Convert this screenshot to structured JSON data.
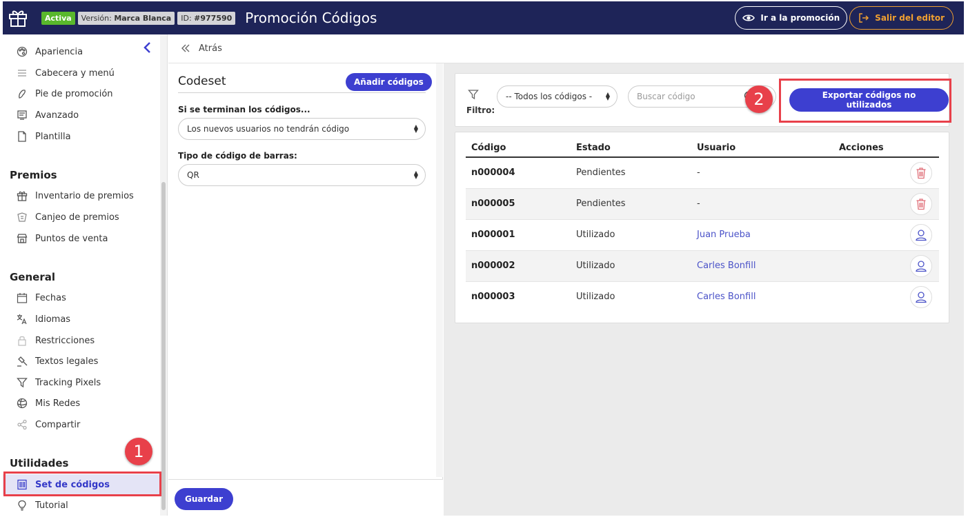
{
  "header": {
    "status_badge": "Activa",
    "version_label": "Versión:",
    "version_value": "Marca Blanca",
    "id_label": "ID:",
    "id_value": "#977590",
    "title": "Promoción Códigos",
    "go_button": "Ir a la promoción",
    "exit_button": "Salir del editor"
  },
  "sidebar": {
    "items_top": [
      {
        "label": "Apariencia",
        "icon": "palette-icon"
      },
      {
        "label": "Cabecera y menú",
        "icon": "menu-icon"
      },
      {
        "label": "Pie de promoción",
        "icon": "footer-icon"
      },
      {
        "label": "Avanzado",
        "icon": "advanced-icon"
      },
      {
        "label": "Plantilla",
        "icon": "template-icon"
      }
    ],
    "section_premios": "Premios",
    "items_premios": [
      {
        "label": "Inventario de premios",
        "icon": "gift-icon"
      },
      {
        "label": "Canjeo de premios",
        "icon": "redeem-icon"
      },
      {
        "label": "Puntos de venta",
        "icon": "store-icon"
      }
    ],
    "section_general": "General",
    "items_general": [
      {
        "label": "Fechas",
        "icon": "calendar-icon"
      },
      {
        "label": "Idiomas",
        "icon": "translate-icon"
      },
      {
        "label": "Restricciones",
        "icon": "lock-icon"
      },
      {
        "label": "Textos legales",
        "icon": "gavel-icon"
      },
      {
        "label": "Tracking Pixels",
        "icon": "funnel-icon"
      },
      {
        "label": "Mis Redes",
        "icon": "network-icon"
      },
      {
        "label": "Compartir",
        "icon": "share-icon"
      }
    ],
    "section_utilidades": "Utilidades",
    "items_utilidades": [
      {
        "label": "Set de códigos",
        "icon": "barcode-icon",
        "active": true
      },
      {
        "label": "Tutorial",
        "icon": "lightbulb-icon"
      }
    ]
  },
  "markers": {
    "one": "1",
    "two": "2"
  },
  "backbar": {
    "label": "Atrás"
  },
  "codeset": {
    "title": "Codeset",
    "add_button": "Añadir códigos",
    "end_label": "Si se terminan los códigos...",
    "end_value": "Los nuevos usuarios no tendrán código",
    "barcode_label": "Tipo de código de barras:",
    "barcode_value": "QR",
    "save_button": "Guardar"
  },
  "filter": {
    "label": "Filtro:",
    "select_value": "-- Todos los códigos -",
    "search_placeholder": "Buscar código",
    "export_button": "Exportar códigos no utilizados"
  },
  "table": {
    "headers": [
      "Código",
      "Estado",
      "Usuario",
      "Acciones"
    ],
    "rows": [
      {
        "code": "n000004",
        "state": "Pendientes",
        "user": "-",
        "action": "trash-icon"
      },
      {
        "code": "n000005",
        "state": "Pendientes",
        "user": "-",
        "action": "trash-icon"
      },
      {
        "code": "n000001",
        "state": "Utilizado",
        "user": "Juan Prueba",
        "action": "user-icon"
      },
      {
        "code": "n000002",
        "state": "Utilizado",
        "user": "Carles Bonfill",
        "action": "user-icon"
      },
      {
        "code": "n000003",
        "state": "Utilizado",
        "user": "Carles Bonfill",
        "action": "user-icon"
      }
    ]
  },
  "colors": {
    "topbar": "#1e2458",
    "accent": "#3d3fd0",
    "active_badge": "#59b82c",
    "exit": "#f0a030",
    "highlight": "#e8404a"
  }
}
